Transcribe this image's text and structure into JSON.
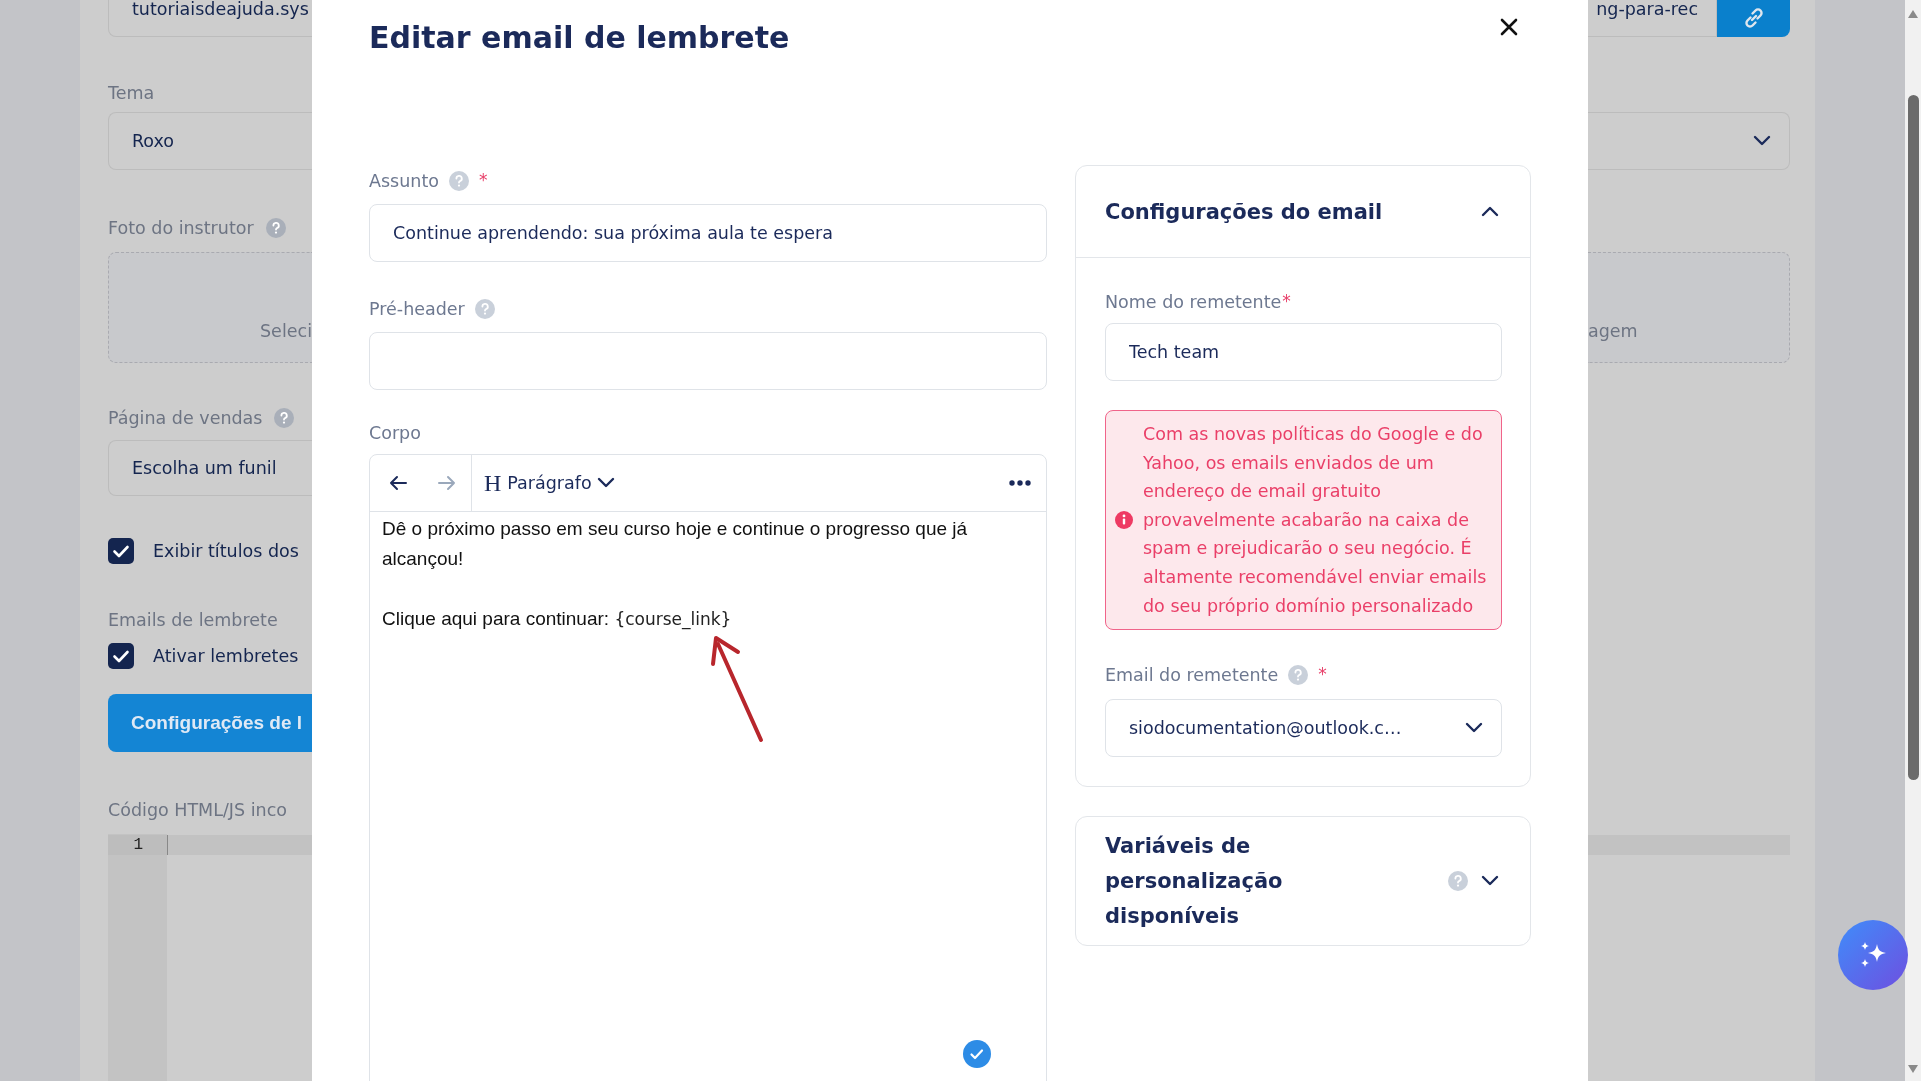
{
  "background_form": {
    "left": {
      "url_value": "tutoriaisdeajuda.sys",
      "theme_label": "Tema",
      "theme_value": "Roxo",
      "photo_label": "Foto do instrutor",
      "photo_drop_text": "Seleci",
      "sales_label": "Página de vendas",
      "sales_value": "Escolha um funil",
      "checkboxes": [
        {
          "label": "Exibir títulos dos",
          "checked": true
        }
      ],
      "reminders_label": "Emails de lembrete",
      "reminder_checkboxes": [
        {
          "label": "Ativar lembretes",
          "checked": true
        }
      ],
      "settings_button": "Configurações de l",
      "code_label": "Código HTML/JS inco",
      "code_line_numbers": [
        "1"
      ]
    },
    "right": {
      "url_value": "ng-para-rec",
      "photo_drop_text": "agem"
    }
  },
  "modal": {
    "title": "Editar email de lembrete",
    "subject": {
      "label": "Assunto",
      "required_mark": "*",
      "value": "Continue aprendendo: sua próxima aula te espera"
    },
    "preheader": {
      "label": "Pré-header"
    },
    "body": {
      "label": "Corpo",
      "toolbar": [
        {
          "kind": "undo",
          "disabled": false
        },
        {
          "kind": "redo",
          "disabled": true
        }
      ],
      "heading_icon": "H",
      "block_format": "Parágrafo",
      "paragraphs": [
        {
          "text": "Dê o próximo passo em seu curso hoje e continue o progresso que já alcançou!"
        },
        {
          "text": "Clique aqui para continuar: ",
          "variable": "{course_link}"
        }
      ],
      "saved": true
    },
    "email_settings": {
      "title": "Configurações do email",
      "expanded": true,
      "sender_name": {
        "label": "Nome do remetente",
        "required_mark": "*",
        "value": "Tech team"
      },
      "alert": "Com as novas políticas do Google e do Yahoo, os emails enviados de um endereço de email gratuito provavelmente acabarão na caixa de spam e prejudicarão o seu negócio. É altamente recomendável enviar emails do seu próprio domínio personalizado",
      "sender_email": {
        "label": "Email do remetente",
        "required_mark": "*",
        "value": "siodocumentation@outlook.c…"
      }
    },
    "variables_panel": {
      "title": "Variáveis de personalização disponíveis",
      "expanded": false
    }
  }
}
